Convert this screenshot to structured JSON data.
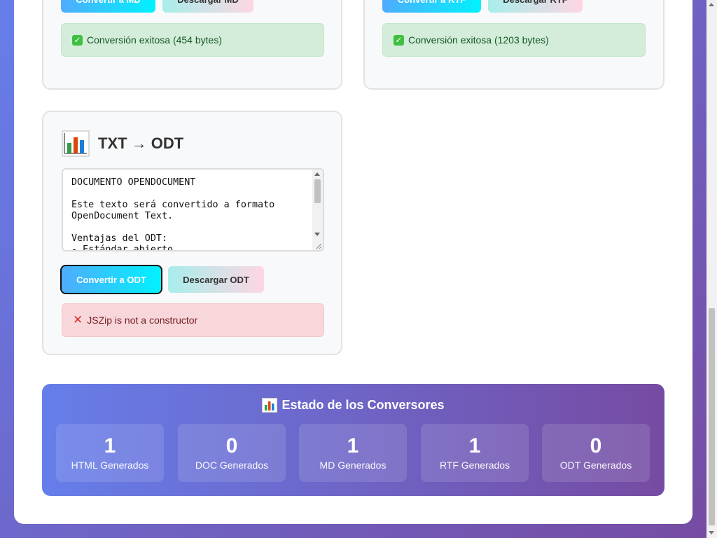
{
  "md_card": {
    "convert_label": "Convertir a MD",
    "download_label": "Descargar MD",
    "status_text": "Conversión exitosa (454 bytes)"
  },
  "rtf_card": {
    "convert_label": "Convertir a RTF",
    "download_label": "Descargar RTF",
    "status_text": "Conversión exitosa (1203 bytes)"
  },
  "odt_card": {
    "title": "TXT → ODT",
    "textarea_text": "DOCUMENTO OPENDOCUMENT\n\nEste texto será convertido a formato OpenDocument Text.\n\nVentajas del ODT:\n- Estándar abierto",
    "convert_label": "Convertir a ODT",
    "download_label": "Descargar ODT",
    "status_text": "JSZip is not a constructor"
  },
  "stats": {
    "title": "Estado de los Conversores",
    "items": [
      {
        "value": "1",
        "label": "HTML Generados"
      },
      {
        "value": "0",
        "label": "DOC Generados"
      },
      {
        "value": "1",
        "label": "MD Generados"
      },
      {
        "value": "1",
        "label": "RTF Generados"
      },
      {
        "value": "0",
        "label": "ODT Generados"
      }
    ]
  },
  "icons": {
    "success": "check-mark-icon",
    "error": "cross-mark-icon",
    "chart": "bar-chart-icon"
  },
  "colors": {
    "primary_gradient_start": "#4facfe",
    "primary_gradient_end": "#00f2fe",
    "secondary_gradient_start": "#a8edea",
    "secondary_gradient_end": "#fed6e3",
    "stats_gradient_start": "#667eea",
    "stats_gradient_end": "#764ba2",
    "success_bg": "#d4edda",
    "error_bg": "#f8d7da"
  }
}
